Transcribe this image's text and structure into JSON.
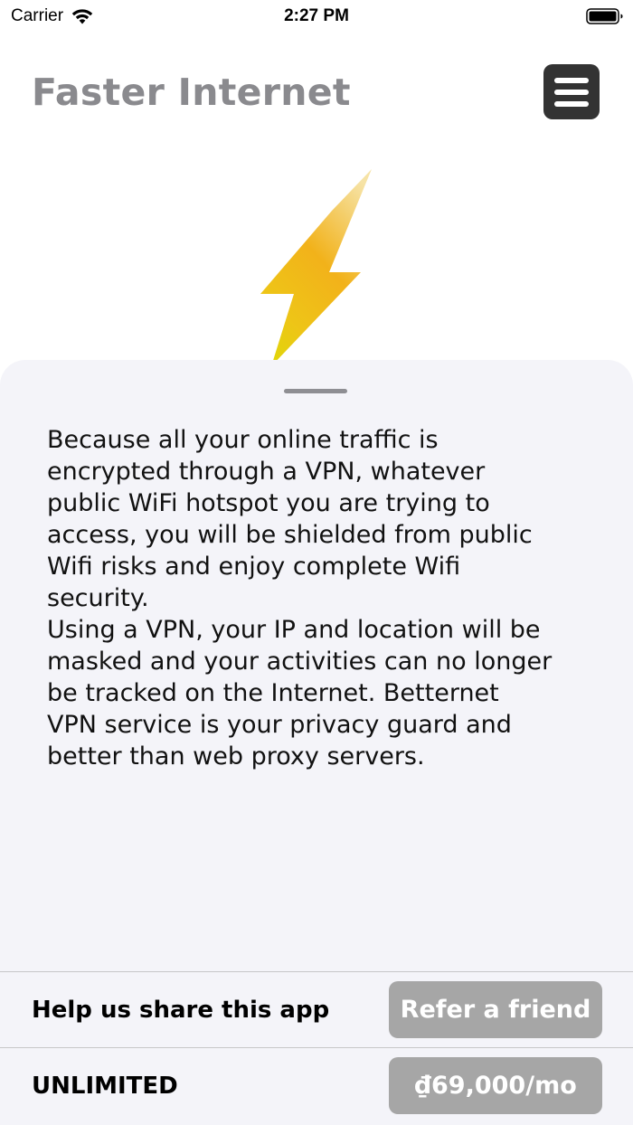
{
  "status_bar": {
    "carrier": "Carrier",
    "time": "2:27 PM",
    "wifi_icon": "wifi-icon",
    "battery_icon": "battery-icon"
  },
  "header": {
    "title": "Faster Internet",
    "menu_icon": "hamburger-menu-icon"
  },
  "hero": {
    "icon": "lightning-bolt-icon",
    "colors": [
      "#f3d27a",
      "#f2b21a",
      "#e3d20e"
    ]
  },
  "sheet": {
    "description": "Because all your online traffic is\nencrypted through a VPN, whatever\npublic WiFi hotspot you are trying to\naccess, you will be shielded from public\nWifi risks and enjoy complete Wifi\nsecurity.\nUsing a VPN, your IP and location will be\nmasked and your activities can no longer\nbe tracked on the Internet. Betternet\nVPN service is your privacy guard and\nbetter than web proxy servers.",
    "share_row": {
      "label": "Help us share this app",
      "button_label": "Refer a friend"
    },
    "unlimited_row": {
      "label": "UNLIMITED",
      "button_label": "₫69,000/mo"
    }
  },
  "colors": {
    "title_gray": "#8a8a8e",
    "menu_button_bg": "#333333",
    "sheet_bg": "#f4f4f9",
    "button_gray": "#a6a6a6"
  }
}
